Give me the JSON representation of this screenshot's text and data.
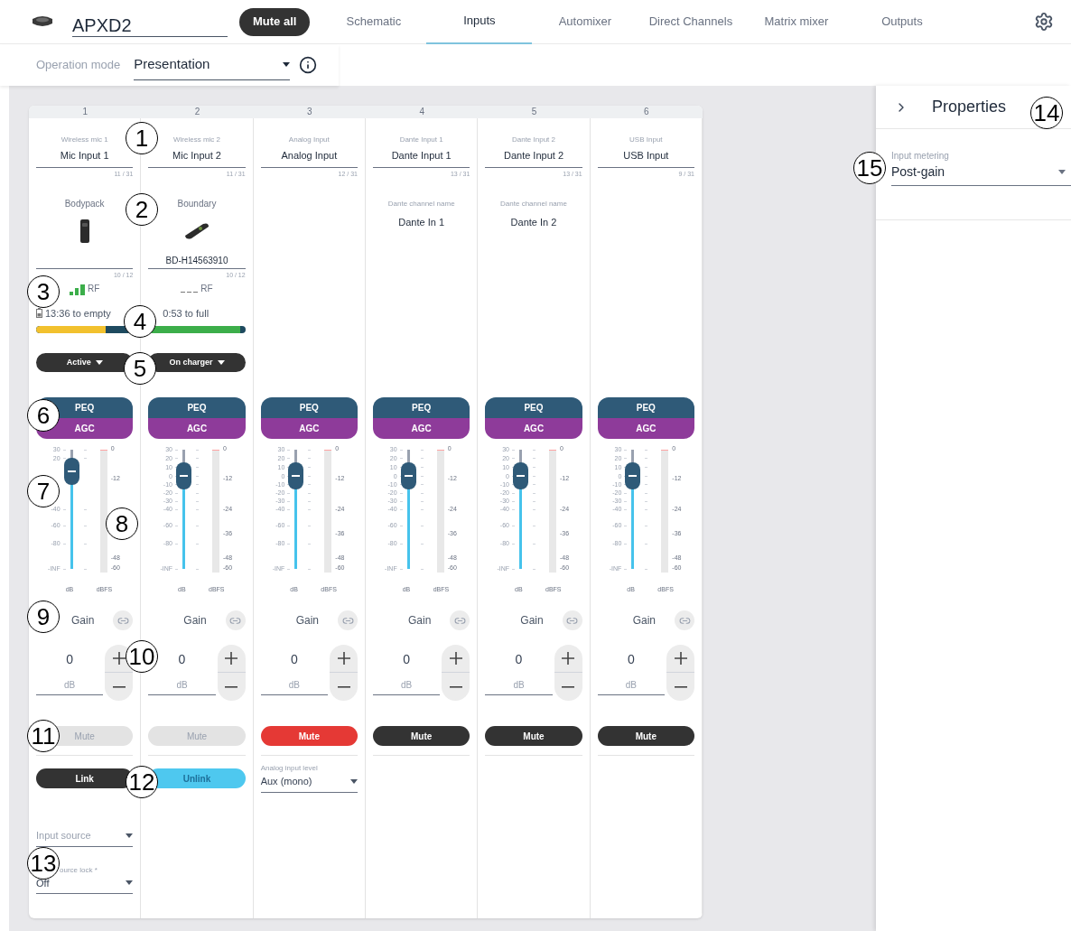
{
  "device": {
    "name": "APXD2"
  },
  "mute_all": "Mute all",
  "tabs": [
    {
      "label": "Schematic",
      "selected": false
    },
    {
      "label": "Inputs",
      "selected": true
    },
    {
      "label": "Automixer",
      "selected": false
    },
    {
      "label": "Direct Channels",
      "selected": false
    },
    {
      "label": "Matrix mixer",
      "selected": false
    },
    {
      "label": "Outputs",
      "selected": false
    }
  ],
  "operation_mode": {
    "label": "Operation mode",
    "value": "Presentation"
  },
  "channels": [
    {
      "number": "1",
      "type": "Wireless mic 1",
      "name": "Mic Input 1",
      "name_count": "11 / 31",
      "device": {
        "kind": "bodypack",
        "label": "Bodypack",
        "count": "10 / 12"
      },
      "rf": {
        "bars": true,
        "label": "RF"
      },
      "battery": {
        "icon": true,
        "text": "13:36 to empty",
        "level": 0.72,
        "charging": false
      },
      "status": "Active",
      "dsp": [
        "PEQ",
        "AGC"
      ],
      "gain": {
        "level": 0.82,
        "scale": [
          "30",
          "20",
          "-40",
          "-60",
          "-80",
          "-INF"
        ],
        "meter_scale": [
          "0",
          "-12",
          "-48",
          "-60"
        ],
        "unit": "dB",
        "meter_unit": "dBFS",
        "label": "Gain",
        "value": "0",
        "value_unit": "dB"
      },
      "mute": {
        "label": "Mute",
        "disabled": true
      },
      "link": {
        "label": "Link",
        "linked": false
      },
      "fields": [
        {
          "placeholder": "Input source"
        },
        {
          "label": "ource lock *",
          "value": "Off"
        }
      ]
    },
    {
      "number": "2",
      "type": "Wireless mic 2",
      "name": "Mic Input 2",
      "name_count": "11 / 31",
      "device": {
        "kind": "boundary",
        "label": "Boundary",
        "serial": "BD-H14563910",
        "count": "10 / 12"
      },
      "rf": {
        "bars": false,
        "label": "RF"
      },
      "battery": {
        "icon": false,
        "text": "0:53 to full",
        "level": 0.95,
        "charging": true
      },
      "status": "On charger",
      "dsp": [
        "PEQ",
        "AGC"
      ],
      "gain": {
        "level": 0.78,
        "scale": [
          "30",
          "20",
          "10",
          "0",
          "-10",
          "-20",
          "-30",
          "-40",
          "-60",
          "-80",
          "-INF"
        ],
        "meter_scale": [
          "0",
          "-12",
          "-24",
          "-36",
          "-48",
          "-60"
        ],
        "unit": "dB",
        "meter_unit": "dBFS",
        "label": "Gain",
        "value": "0",
        "value_unit": "dB"
      },
      "mute": {
        "label": "Mute",
        "disabled": true
      },
      "link": {
        "label": "Unlink",
        "linked": true
      }
    },
    {
      "number": "3",
      "type": "Analog Input",
      "name": "Analog Input",
      "name_count": "12 / 31",
      "dsp": [
        "PEQ",
        "AGC"
      ],
      "gain": {
        "level": 0.78,
        "scale": [
          "30",
          "20",
          "10",
          "0",
          "-10",
          "-20",
          "-30",
          "-40",
          "-60",
          "-80",
          "-INF"
        ],
        "meter_scale": [
          "0",
          "-12",
          "-24",
          "-36",
          "-48",
          "-60"
        ],
        "unit": "dB",
        "meter_unit": "dBFS",
        "label": "Gain",
        "value": "0",
        "value_unit": "dB"
      },
      "mute": {
        "label": "Mute",
        "muted": true,
        "disabled": false
      },
      "fields": [
        {
          "label": "Analog input level",
          "value": "Aux (mono)"
        }
      ]
    },
    {
      "number": "4",
      "type": "Dante Input 1",
      "name": "Dante Input 1",
      "name_count": "13 / 31",
      "dante": {
        "label": "Dante channel name",
        "value": "Dante In 1"
      },
      "dsp": [
        "PEQ",
        "AGC"
      ],
      "gain": {
        "level": 0.78,
        "scale": [
          "30",
          "20",
          "10",
          "0",
          "-10",
          "-20",
          "-30",
          "-40",
          "-60",
          "-80",
          "-INF"
        ],
        "meter_scale": [
          "0",
          "-12",
          "-24",
          "-36",
          "-48",
          "-60"
        ],
        "unit": "dB",
        "meter_unit": "dBFS",
        "label": "Gain",
        "value": "0",
        "value_unit": "dB"
      },
      "mute": {
        "label": "Mute",
        "muted": false,
        "disabled": false
      }
    },
    {
      "number": "5",
      "type": "Dante Input 2",
      "name": "Dante Input 2",
      "name_count": "13 / 31",
      "dante": {
        "label": "Dante channel name",
        "value": "Dante In 2"
      },
      "dsp": [
        "PEQ",
        "AGC"
      ],
      "gain": {
        "level": 0.78,
        "scale": [
          "30",
          "20",
          "10",
          "0",
          "-10",
          "-20",
          "-30",
          "-40",
          "-60",
          "-80",
          "-INF"
        ],
        "meter_scale": [
          "0",
          "-12",
          "-24",
          "-36",
          "-48",
          "-60"
        ],
        "unit": "dB",
        "meter_unit": "dBFS",
        "label": "Gain",
        "value": "0",
        "value_unit": "dB"
      },
      "mute": {
        "label": "Mute",
        "muted": false,
        "disabled": false
      }
    },
    {
      "number": "6",
      "type": "USB Input",
      "name": "USB Input",
      "name_count": "9 / 31",
      "dsp": [
        "PEQ",
        "AGC"
      ],
      "gain": {
        "level": 0.78,
        "scale": [
          "30",
          "20",
          "10",
          "0",
          "-10",
          "-20",
          "-30",
          "-40",
          "-60",
          "-80",
          "-INF"
        ],
        "meter_scale": [
          "0",
          "-12",
          "-24",
          "-36",
          "-48",
          "-60"
        ],
        "unit": "dB",
        "meter_unit": "dBFS",
        "label": "Gain",
        "value": "0",
        "value_unit": "dB"
      },
      "mute": {
        "label": "Mute",
        "muted": false,
        "disabled": false
      }
    }
  ],
  "properties": {
    "title": "Properties",
    "input_metering": {
      "label": "Input metering",
      "value": "Post-gain"
    }
  },
  "callouts": [
    "1",
    "2",
    "3",
    "4",
    "5",
    "6",
    "7",
    "8",
    "9",
    "10",
    "11",
    "12",
    "13",
    "14",
    "15"
  ]
}
